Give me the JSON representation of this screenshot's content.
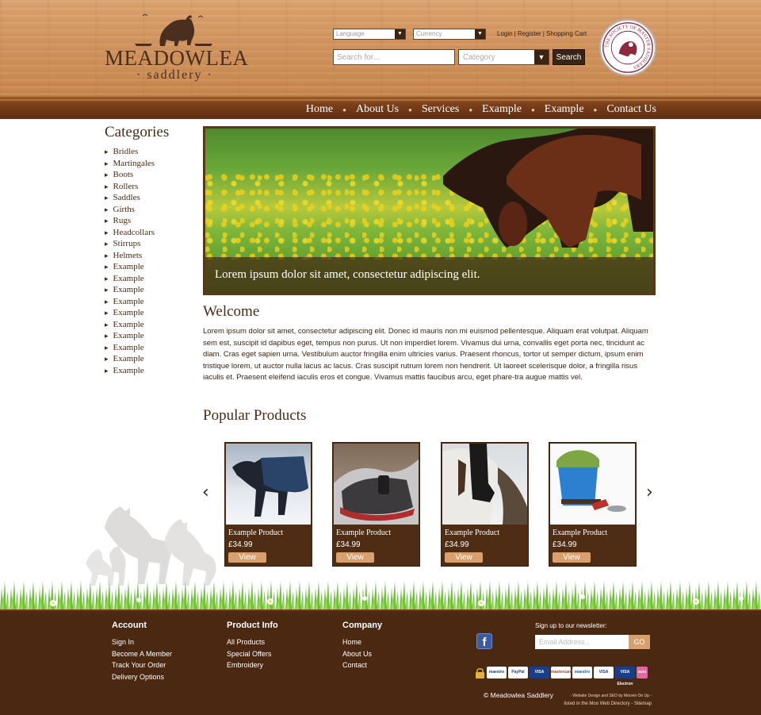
{
  "brand": {
    "name": "MEADOWLEA",
    "subtitle": "· saddlery ·",
    "seal_text": "THE SOCIETY OF MASTER SADDLERS"
  },
  "header": {
    "language_label": "Language",
    "currency_label": "Currency",
    "login": "Login",
    "register": "Register",
    "cart": "Shopping Cart",
    "search_placeholder": "Search for...",
    "category_placeholder": "Category",
    "search_button": "Search"
  },
  "nav": [
    "Home",
    "About Us",
    "Services",
    "Example",
    "Example",
    "Contact Us"
  ],
  "sidebar": {
    "title": "Categories",
    "items": [
      "Bridles",
      "Martingales",
      "Boots",
      "Rollers",
      "Saddles",
      "Girths",
      "Rugs",
      "Headcollars",
      "Stirrups",
      "Helmets",
      "Example",
      "Example",
      "Example",
      "Example",
      "Example",
      "Example",
      "Example",
      "Example",
      "Example",
      "Example"
    ]
  },
  "banner": {
    "caption": "Lorem ipsum dolor sit amet, consectetur adipiscing elit."
  },
  "welcome": {
    "title": "Welcome",
    "text": "Lorem ipsum dolor sit amet, consectetur adipiscing elit. Donec id mauris non mi euismod pellentesque. Aliquam erat volutpat. Aliquam sem est, suscipit id dapibus eget, tempus non purus. Ut non imperdiet lorem. Vivamus dui urna, convallis eget porta nec, tincidunt ac diam. Cras eget sapien urna.  Vestibulum auctor fringilla enim ultricies varius. Praesent rhoncus, tortor ut semper dictum, ipsum enim tristique lorem, ut auctor nulla lacus ac lacus. Cras suscipit rutrum lorem non hendrerit. Ut laoreet scelerisque dolor, a fringilla risus iaculis et. Praesent eleifend iaculis eros et congue. Vivamus mattis faucibus arcu, eget phare-tra augue mattis vel."
  },
  "popular": {
    "title": "Popular Products",
    "prev_icon": "‹",
    "next_icon": "›",
    "products": [
      {
        "name": "Example Product",
        "price": "£34.99",
        "button": "View"
      },
      {
        "name": "Example Product",
        "price": "£34.99",
        "button": "View"
      },
      {
        "name": "Example Product",
        "price": "£34.99",
        "button": "View"
      },
      {
        "name": "Example Product",
        "price": "£34.99",
        "button": "View"
      }
    ]
  },
  "footer": {
    "account": {
      "title": "Account",
      "links": [
        "Sign In",
        "Become A Member",
        "Track Your Order",
        "Delivery Options"
      ]
    },
    "product_info": {
      "title": "Product Info",
      "links": [
        "All Products",
        "Special Offers",
        "Embroidery"
      ]
    },
    "company": {
      "title": "Company",
      "links": [
        "Home",
        "About Us",
        "Contact"
      ]
    },
    "newsletter_label": "Sign up to our newsletter:",
    "email_placeholder": "Email Address...",
    "go_button": "GO",
    "facebook_icon": "f",
    "payments": [
      "maestro",
      "PayPal",
      "VISA",
      "mastercard",
      "maestro",
      "VISA",
      "VISA Electron",
      "solo"
    ],
    "copyright": "© Meadowlea Saddlery",
    "credits_1": "- Website Design and SEO by Moovin On Up -",
    "credits_2": "listed in the Moo Web Directory - Sitemap"
  }
}
